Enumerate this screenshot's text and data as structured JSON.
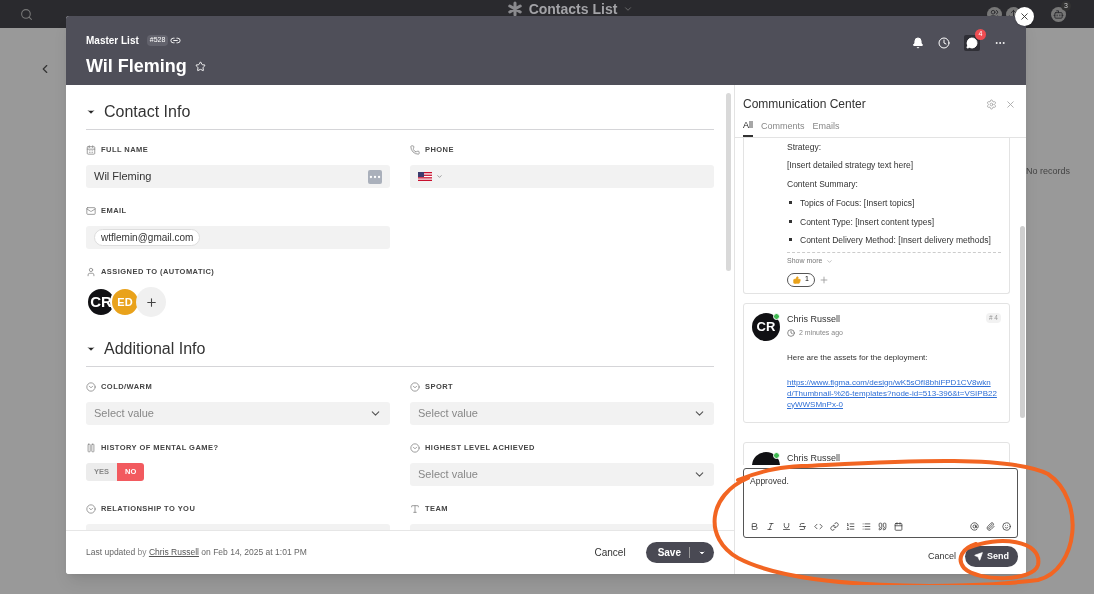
{
  "app_bar": {
    "title": "Contacts List",
    "notification_count": "3"
  },
  "background": {
    "empty_text": "No records"
  },
  "record": {
    "list_name": "Master List",
    "record_id": "#528",
    "title": "Wil Fleming",
    "starred": false,
    "chat_badge": "4"
  },
  "sections": [
    {
      "title": "Contact Info",
      "expanded": true,
      "fields": [
        {
          "kind": "text",
          "label": "FULL NAME",
          "value": "Wil Fleming"
        },
        {
          "kind": "phone",
          "label": "PHONE"
        },
        {
          "kind": "email",
          "label": "EMAIL",
          "value": "wtflemin@gmail.com"
        },
        {
          "kind": "spacer"
        },
        {
          "kind": "assignees",
          "label": "ASSIGNED TO (AUTOMATIC)",
          "people": [
            {
              "initials": "CR",
              "color": "#111114"
            },
            {
              "initials": "ED",
              "color": "#e9a21b"
            }
          ]
        }
      ]
    },
    {
      "title": "Additional Info",
      "expanded": true,
      "fields": [
        {
          "kind": "select",
          "label": "COLD/WARM",
          "placeholder": "Select value"
        },
        {
          "kind": "select",
          "label": "SPORT",
          "placeholder": "Select value"
        },
        {
          "kind": "toggle",
          "label": "HISTORY OF MENTAL GAME?",
          "options": [
            {
              "label": "YES",
              "selected": false
            },
            {
              "label": "NO",
              "selected": true
            }
          ]
        },
        {
          "kind": "select",
          "label": "HIGHEST LEVEL ACHIEVED",
          "placeholder": "Select value"
        },
        {
          "kind": "select_cut",
          "label": "RELATIONSHIP TO YOU"
        },
        {
          "kind": "text_cut",
          "label": "TEAM"
        }
      ]
    }
  ],
  "footer": {
    "updated": "Last updated",
    "by": "by",
    "user": "Chris Russell",
    "when": "on Feb 14, 2025 at 1:01 PM",
    "cancel": "Cancel",
    "save": "Save"
  },
  "comm": {
    "title": "Communication Center",
    "tabs": [
      {
        "label": "All",
        "selected": true
      },
      {
        "label": "Comments",
        "selected": false
      },
      {
        "label": "Emails",
        "selected": false
      }
    ],
    "posts": [
      {
        "kind": "cut_top",
        "lines": [
          {
            "kind": "p",
            "text": "Strategy:"
          },
          {
            "kind": "p",
            "text": "[Insert detailed strategy text here]"
          },
          {
            "kind": "p",
            "text": "Content Summary:"
          },
          {
            "kind": "bullet",
            "text": "Topics of Focus: [Insert topics]"
          },
          {
            "kind": "bullet",
            "text": "Content Type: [Insert content types]"
          },
          {
            "kind": "bullet",
            "text": "Content Delivery Method: [Insert delivery methods]"
          }
        ],
        "show_more": "Show more",
        "reaction_count": "1"
      },
      {
        "kind": "full",
        "author": "Chris Russell",
        "initials": "CR",
        "online": true,
        "time": "2 minutes ago",
        "number": "# 4",
        "text": "Here are the assets for the deployment:",
        "link": "https://www.figma.com/design/wK5sOfI8bhiFPD1CV8wknd/Thumbnail-%26-templates?node-id=513-396&t=VSIPB22cyWWSMnPx-0"
      },
      {
        "kind": "cut_bottom",
        "author": "Chris Russell",
        "online": true
      }
    ],
    "composer": {
      "value": "Approved.",
      "cancel": "Cancel",
      "send": "Send"
    }
  }
}
